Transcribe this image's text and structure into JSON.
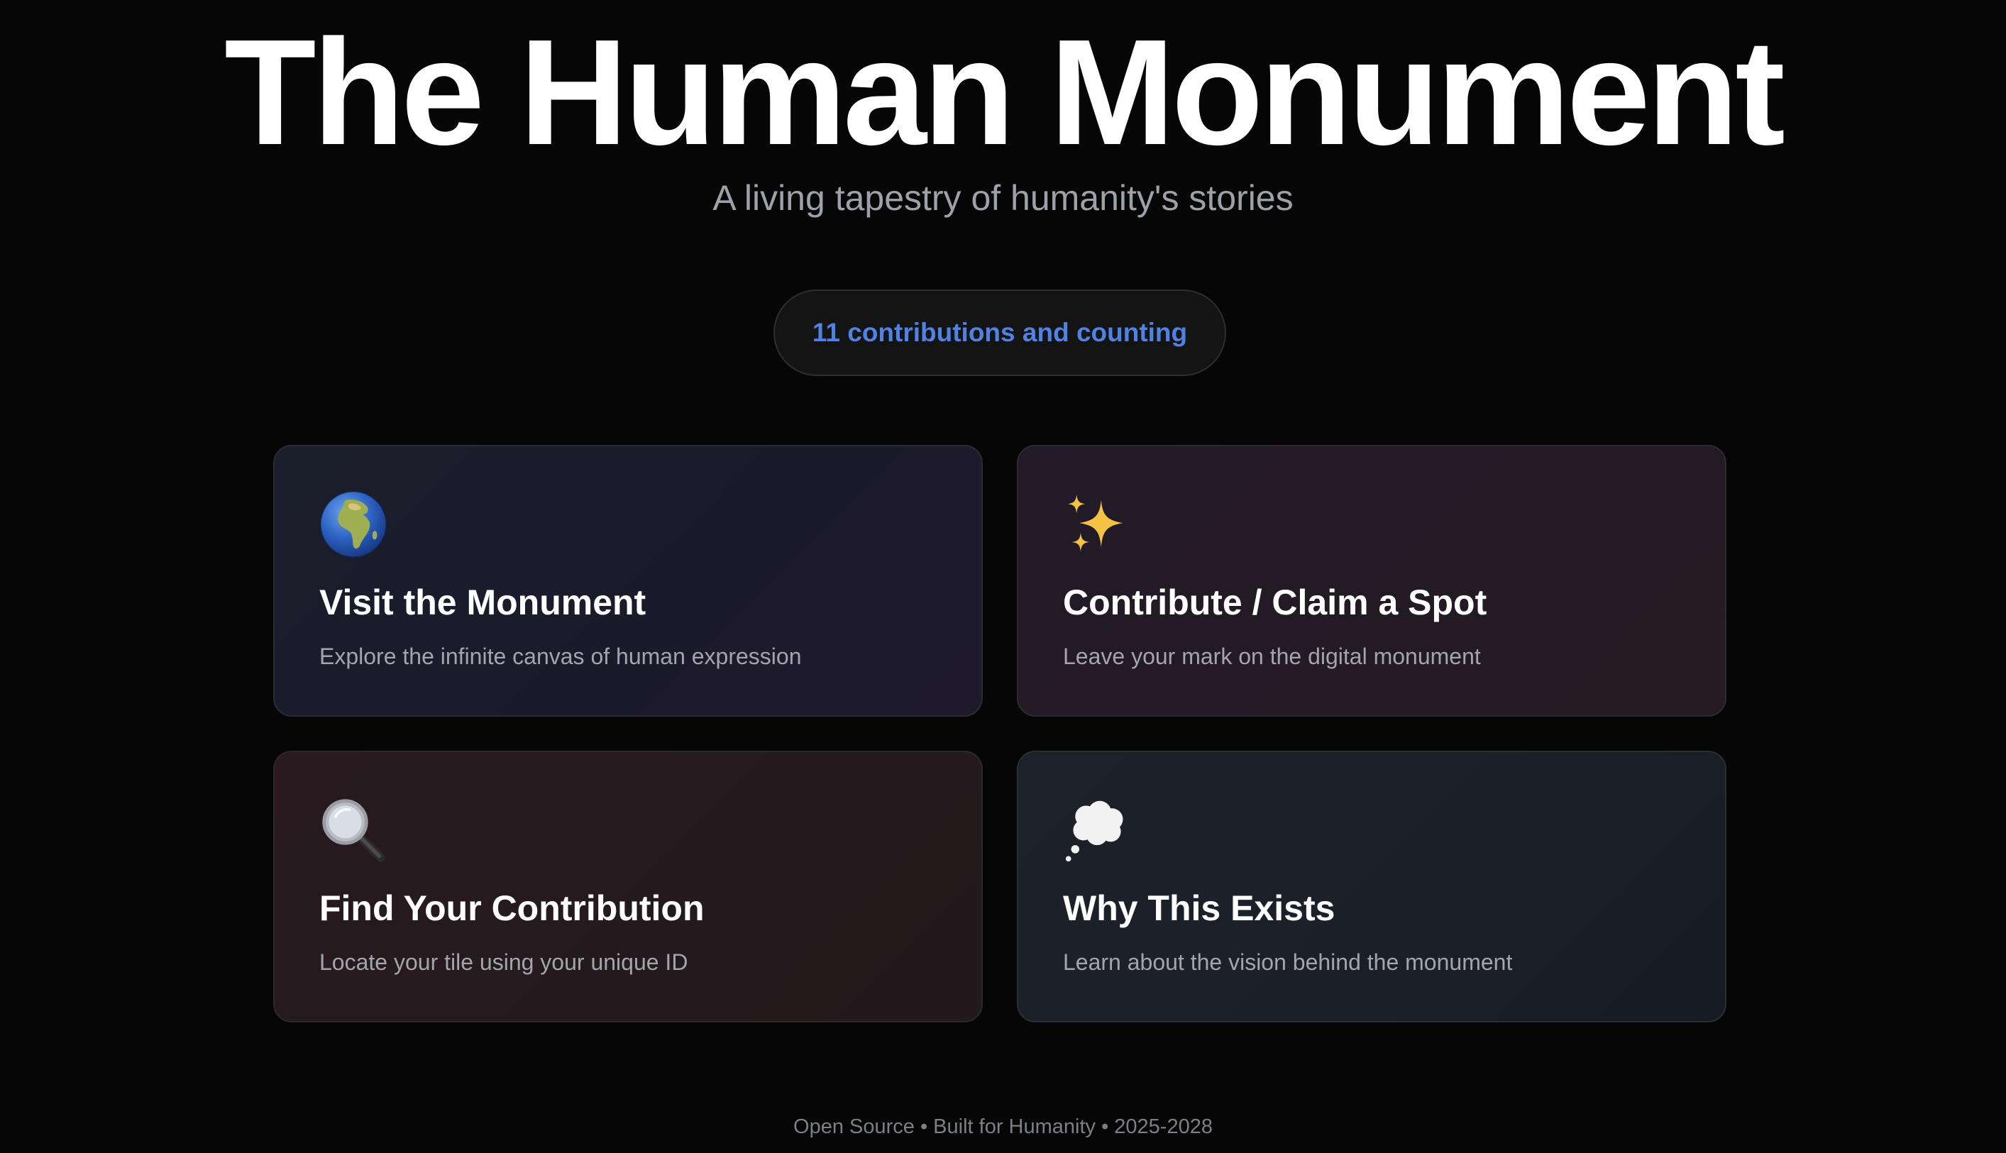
{
  "hero": {
    "title": "The Human Monument",
    "subtitle": "A living tapestry of humanity's stories"
  },
  "counter": {
    "text": "11 contributions and counting",
    "color": "#4f82e3"
  },
  "cards": [
    {
      "icon": "globe-africa-icon",
      "title": "Visit the Monument",
      "description": "Explore the infinite canvas of human expression"
    },
    {
      "icon": "sparkles-icon",
      "title": "Contribute / Claim a Spot",
      "description": "Leave your mark on the digital monument"
    },
    {
      "icon": "magnifying-glass-icon",
      "title": "Find Your Contribution",
      "description": "Locate your tile using your unique ID"
    },
    {
      "icon": "thought-balloon-icon",
      "title": "Why This Exists",
      "description": "Learn about the vision behind the monument"
    }
  ],
  "footer": {
    "text": "Open Source • Built for Humanity • 2025-2028"
  }
}
